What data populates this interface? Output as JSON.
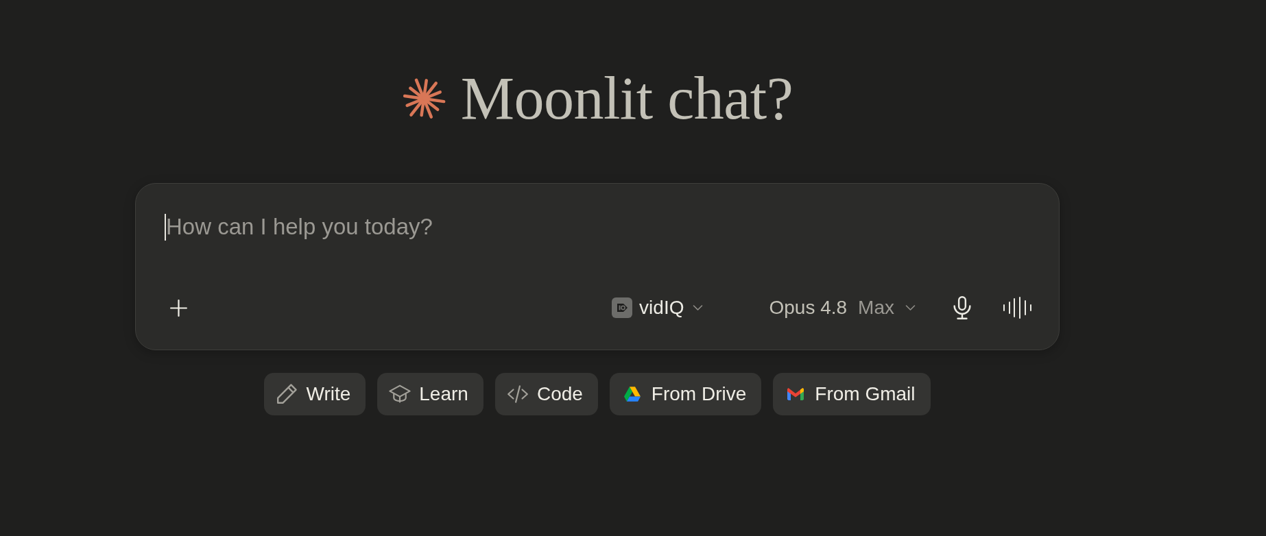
{
  "heading": {
    "title": "Moonlit chat?"
  },
  "composer": {
    "placeholder": "How can I help you today?",
    "tool": {
      "label": "vidIQ"
    },
    "model": {
      "name": "Opus 4.8",
      "effort": "Max"
    }
  },
  "suggestions": [
    {
      "kind": "write",
      "label": "Write"
    },
    {
      "kind": "learn",
      "label": "Learn"
    },
    {
      "kind": "code",
      "label": "Code"
    },
    {
      "kind": "drive",
      "label": "From Drive"
    },
    {
      "kind": "gmail",
      "label": "From Gmail"
    }
  ]
}
